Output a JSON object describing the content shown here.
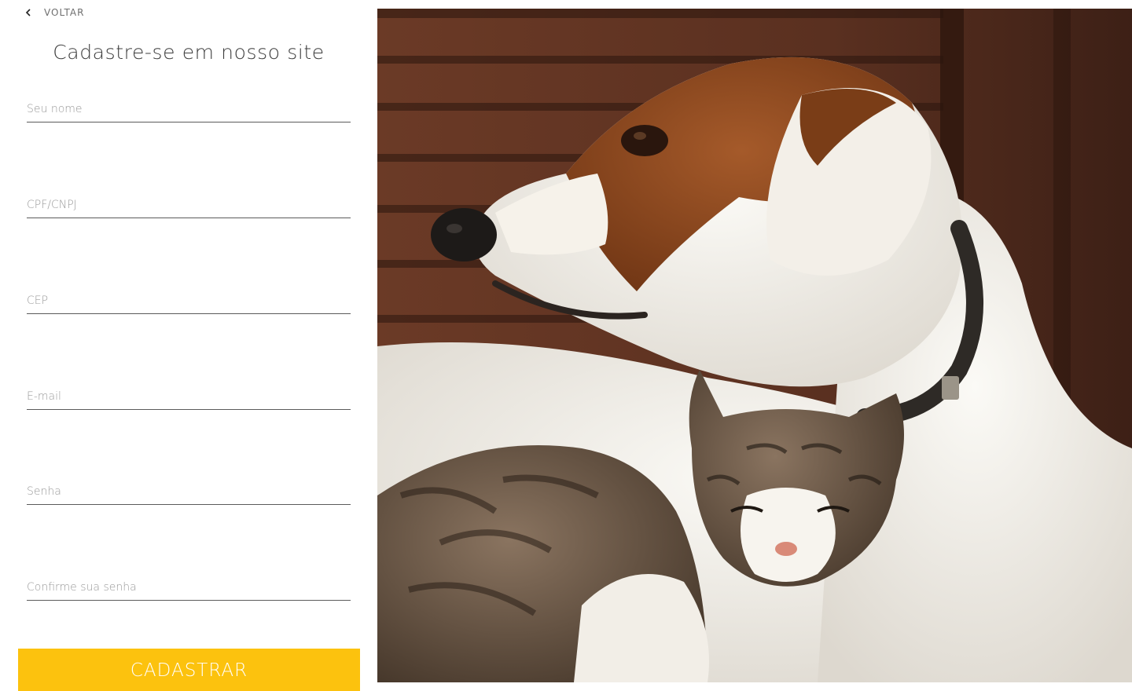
{
  "nav": {
    "back_label": "VOLTAR",
    "back_icon": "chevron-left-icon"
  },
  "form": {
    "title": "Cadastre-se em nosso site",
    "fields": [
      {
        "name": "name-field",
        "placeholder": "Seu nome",
        "value": ""
      },
      {
        "name": "cpf-cnpj-field",
        "placeholder": "CPF/CNPJ",
        "value": ""
      },
      {
        "name": "cep-field",
        "placeholder": "CEP",
        "value": ""
      },
      {
        "name": "email-field",
        "placeholder": "E-mail",
        "value": ""
      },
      {
        "name": "password-field",
        "placeholder": "Senha",
        "value": ""
      },
      {
        "name": "confirm-password-field",
        "placeholder": "Confirme sua senha",
        "value": ""
      }
    ],
    "submit_label": "CADASTRAR"
  },
  "colors": {
    "accent": "#fcc20e",
    "input_line": "#5b5b5b",
    "placeholder": "#9a9a9a",
    "title_text": "#3e3e3e"
  }
}
